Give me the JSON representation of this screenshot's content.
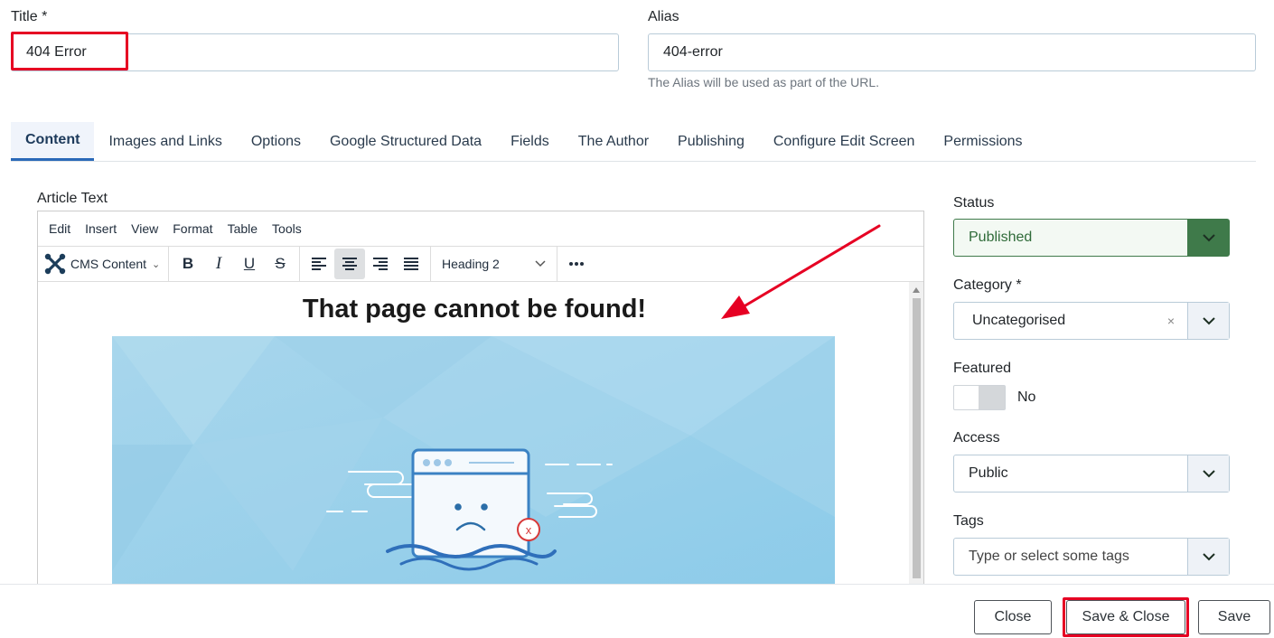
{
  "form": {
    "title_label": "Title *",
    "title_value": "404 Error",
    "alias_label": "Alias",
    "alias_value": "404-error",
    "alias_hint": "The Alias will be used as part of the URL."
  },
  "tabs": [
    {
      "label": "Content"
    },
    {
      "label": "Images and Links"
    },
    {
      "label": "Options"
    },
    {
      "label": "Google Structured Data"
    },
    {
      "label": "Fields"
    },
    {
      "label": "The Author"
    },
    {
      "label": "Publishing"
    },
    {
      "label": "Configure Edit Screen"
    },
    {
      "label": "Permissions"
    }
  ],
  "editor": {
    "label": "Article Text",
    "menu": [
      "Edit",
      "Insert",
      "View",
      "Format",
      "Table",
      "Tools"
    ],
    "cms_content_label": "CMS Content",
    "block_format": "Heading 2",
    "heading_text": "That page cannot be found!",
    "error_badge": "x"
  },
  "sidebar": {
    "status_label": "Status",
    "status_value": "Published",
    "category_label": "Category *",
    "category_value": "Uncategorised",
    "category_clear": "×",
    "featured_label": "Featured",
    "featured_value": "No",
    "access_label": "Access",
    "access_value": "Public",
    "tags_label": "Tags",
    "tags_placeholder": "Type or select some tags"
  },
  "footer": {
    "close_label": "Close",
    "save_close_label": "Save & Close",
    "save_label": "Save"
  },
  "colors": {
    "highlight": "#e60023",
    "status_green": "#3f7a4a",
    "tab_active_bg": "#f0f4fb"
  }
}
